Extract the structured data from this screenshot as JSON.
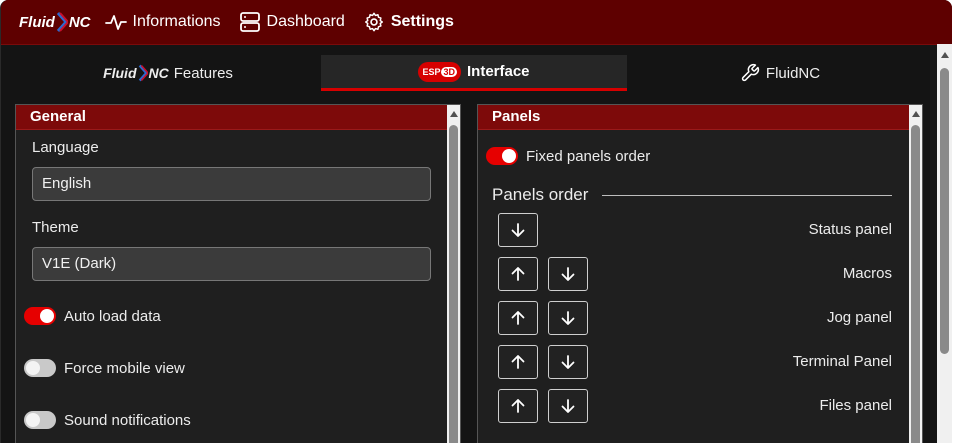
{
  "nav": {
    "brand_left": "Fluid",
    "brand_right": "NC",
    "items": [
      {
        "label": "Informations",
        "icon": "activity-icon"
      },
      {
        "label": "Dashboard",
        "icon": "server-icon"
      },
      {
        "label": "Settings",
        "icon": "gear-icon",
        "active": true
      }
    ]
  },
  "tabs": [
    {
      "brand_left": "Fluid",
      "brand_right": "NC",
      "label": "Features"
    },
    {
      "badge_left": "ESP",
      "badge_right": "3D",
      "label": "Interface",
      "active": true
    },
    {
      "label": "FluidNC",
      "icon": "wrench-icon"
    }
  ],
  "general": {
    "title": "General",
    "language_label": "Language",
    "language_value": "English",
    "theme_label": "Theme",
    "theme_value": "V1E (Dark)",
    "toggles": [
      {
        "label": "Auto load data",
        "on": true
      },
      {
        "label": "Force mobile view",
        "on": false
      },
      {
        "label": "Sound notifications",
        "on": false
      }
    ]
  },
  "panels": {
    "title": "Panels",
    "fixed_label": "Fixed panels order",
    "fixed_on": true,
    "order_title": "Panels order",
    "order_items": [
      {
        "label": "Status panel",
        "up": false,
        "down": true
      },
      {
        "label": "Macros",
        "up": true,
        "down": true
      },
      {
        "label": "Jog panel",
        "up": true,
        "down": true
      },
      {
        "label": "Terminal Panel",
        "up": true,
        "down": true
      },
      {
        "label": "Files panel",
        "up": true,
        "down": true
      }
    ]
  },
  "colors": {
    "accent": "#e60000",
    "header": "#5e0000",
    "panel_header": "#7d0a0a"
  }
}
